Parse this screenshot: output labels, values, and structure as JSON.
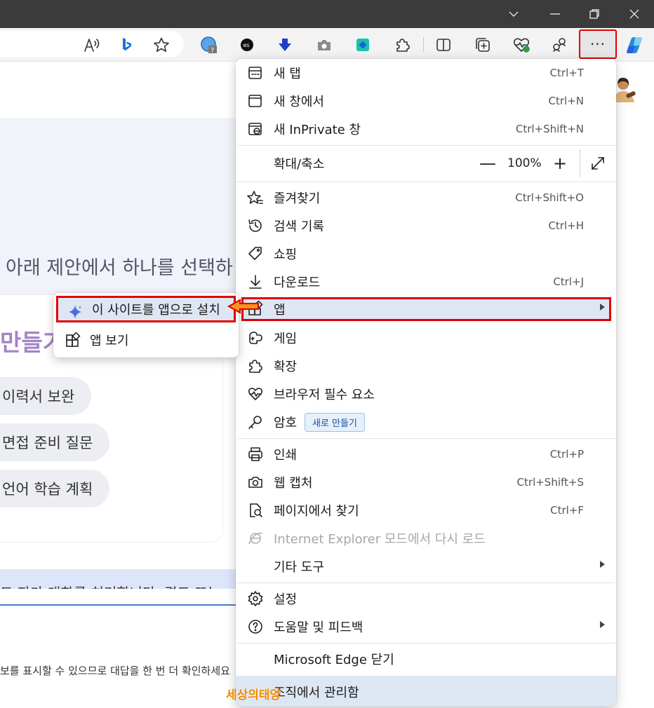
{
  "toolbar": {
    "more_label": "···"
  },
  "page": {
    "hero_text": "아래 제안에서 하나를 선택하",
    "make_title": "만들기",
    "suggestions": [
      "이력서 보완",
      "면접 준비 질문",
      "언어 학습 계획"
    ],
    "notice": "트 자가 대화를 처리합니다. 겸토 또는",
    "bottom_note": "보를 표시할 수 있으므로 대답을 한 번 더 확인하세요"
  },
  "menu": {
    "new_tab": {
      "label": "새 탭",
      "shortcut": "Ctrl+T"
    },
    "new_window": {
      "label": "새 창에서",
      "shortcut": "Ctrl+N"
    },
    "new_inprivate": {
      "label": "새 InPrivate 창",
      "shortcut": "Ctrl+Shift+N"
    },
    "zoom": {
      "label": "확대/축소",
      "minus": "—",
      "value": "100%",
      "plus": "+"
    },
    "favorites": {
      "label": "즐겨찾기",
      "shortcut": "Ctrl+Shift+O"
    },
    "history": {
      "label": "검색 기록",
      "shortcut": "Ctrl+H"
    },
    "shopping": {
      "label": "쇼핑"
    },
    "downloads": {
      "label": "다운로드",
      "shortcut": "Ctrl+J"
    },
    "apps": {
      "label": "앱"
    },
    "games": {
      "label": "게임"
    },
    "extensions": {
      "label": "확장"
    },
    "essentials": {
      "label": "브라우저 필수 요소"
    },
    "passwords": {
      "label": "암호",
      "badge": "새로 만들기"
    },
    "print": {
      "label": "인쇄",
      "shortcut": "Ctrl+P"
    },
    "web_capture": {
      "label": "웹 캡처",
      "shortcut": "Ctrl+Shift+S"
    },
    "find": {
      "label": "페이지에서 찾기",
      "shortcut": "Ctrl+F"
    },
    "ie_mode": {
      "label": "Internet Explorer 모드에서 다시 로드"
    },
    "more_tools": {
      "label": "기타 도구"
    },
    "settings": {
      "label": "설정"
    },
    "help": {
      "label": "도움말 및 피드백"
    },
    "close_edge": {
      "label": "Microsoft Edge 닫기"
    },
    "managed": {
      "label": "조직에서 관리함"
    }
  },
  "submenu": {
    "install_site": "이 사이트를 앱으로 설치",
    "view_apps": "앱 보기"
  },
  "watermark": "세상의태양",
  "colors": {
    "highlight_border": "#e00000",
    "highlight_bg": "#dfe6f3",
    "accent": "#1a6fd4"
  }
}
